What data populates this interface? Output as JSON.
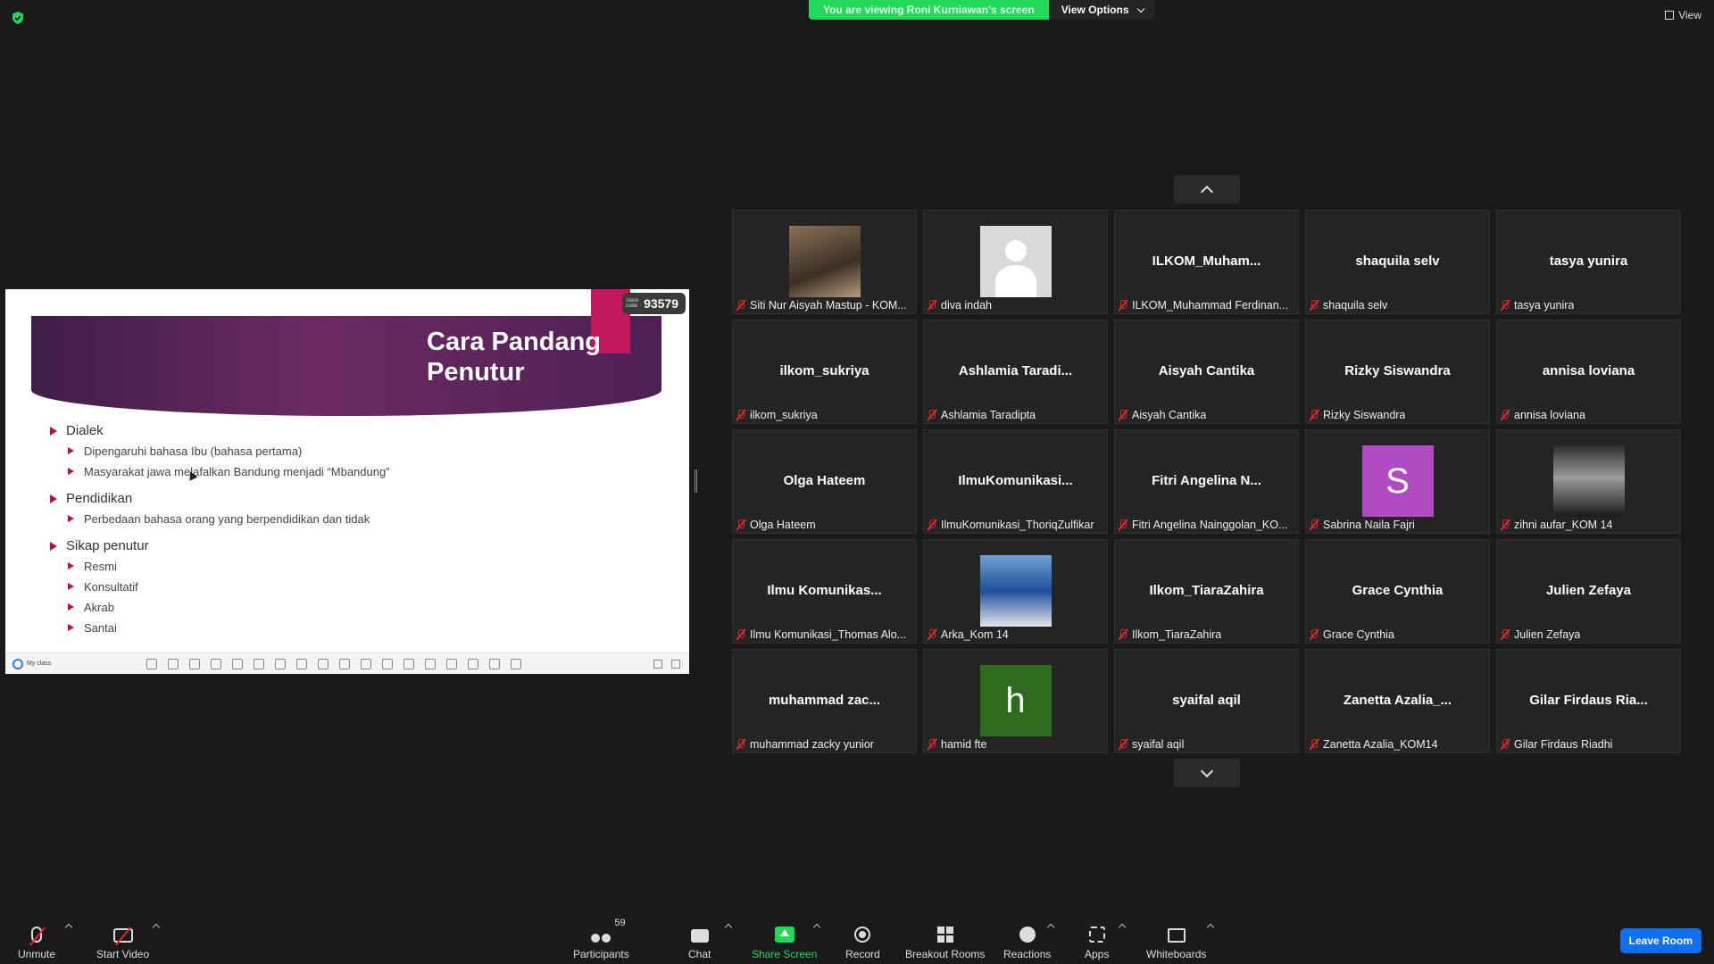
{
  "banner": {
    "viewing": "You are viewing Roni Kurniawan's screen",
    "view_options": "View Options"
  },
  "view_button": "View",
  "slide": {
    "title": "Cara Pandang Penutur",
    "class_code_label": "class code",
    "class_code": "93579",
    "bullets": [
      {
        "text": "Dialek",
        "sub": [
          "Dipengaruhi bahasa Ibu (bahasa pertama)",
          "Masyarakat jawa melafalkan Bandung menjadi “Mbandung”"
        ]
      },
      {
        "text": "Pendidikan",
        "sub": [
          "Perbedaan bahasa orang yang berpendidikan dan tidak"
        ]
      },
      {
        "text": "Sikap penutur",
        "sub": [
          "Resmi",
          "Konsultatif",
          "Akrab",
          "Santai"
        ]
      }
    ],
    "toolbar_label": "My class",
    "accent_color": "#c2185b"
  },
  "participants": [
    {
      "display": "",
      "avatar": "photo1",
      "name": "Siti Nur Aisyah Mastup - KOM..."
    },
    {
      "display": "",
      "avatar": "default",
      "name": "diva indah"
    },
    {
      "display": "ILKOM_Muham...",
      "avatar": "",
      "name": "ILKOM_Muhammad Ferdinan..."
    },
    {
      "display": "shaquila selv",
      "avatar": "",
      "name": "shaquila selv"
    },
    {
      "display": "tasya yunira",
      "avatar": "",
      "name": "tasya yunira"
    },
    {
      "display": "ilkom_sukriya",
      "avatar": "",
      "name": "ilkom_sukriya"
    },
    {
      "display": "Ashlamia Taradi...",
      "avatar": "",
      "name": "Ashlamia Taradipta"
    },
    {
      "display": "Aisyah Cantika",
      "avatar": "",
      "name": "Aisyah Cantika"
    },
    {
      "display": "Rizky Siswandra",
      "avatar": "",
      "name": "Rizky Siswandra"
    },
    {
      "display": "annisa loviana",
      "avatar": "",
      "name": "annisa loviana"
    },
    {
      "display": "Olga Hateem",
      "avatar": "",
      "name": "Olga Hateem"
    },
    {
      "display": "IlmuKomunikasi...",
      "avatar": "",
      "name": "IlmuKomunikasi_ThoriqZulfikar"
    },
    {
      "display": "Fitri Angelina N...",
      "avatar": "",
      "name": "Fitri Angelina Nainggolan_KO..."
    },
    {
      "display": "",
      "avatar": "letter",
      "letter": "S",
      "letter_color": "#b04bc4",
      "name": "Sabrina Naila Fajri"
    },
    {
      "display": "",
      "avatar": "photo2",
      "name": "zihni aufar_KOM 14"
    },
    {
      "display": "Ilmu Komunikas...",
      "avatar": "",
      "name": "Ilmu Komunikasi_Thomas Alo..."
    },
    {
      "display": "",
      "avatar": "photo3",
      "name": "Arka_Kom 14"
    },
    {
      "display": "Ilkom_TiaraZahira",
      "avatar": "",
      "name": "Ilkom_TiaraZahira"
    },
    {
      "display": "Grace Cynthia",
      "avatar": "",
      "name": "Grace Cynthia"
    },
    {
      "display": "Julien Zefaya",
      "avatar": "",
      "name": "Julien Zefaya"
    },
    {
      "display": "muhammad zac...",
      "avatar": "",
      "name": "muhammad zacky yunior"
    },
    {
      "display": "",
      "avatar": "letter",
      "letter": "h",
      "letter_color": "#2e6b1e",
      "name": "hamid fte"
    },
    {
      "display": "syaifal aqil",
      "avatar": "",
      "name": "syaifal aqil"
    },
    {
      "display": "Zanetta Azalia_...",
      "avatar": "",
      "name": "Zanetta Azalia_KOM14"
    },
    {
      "display": "Gilar Firdaus Ria...",
      "avatar": "",
      "name": "Gilar Firdaus Riadhi"
    }
  ],
  "toolbar": {
    "unmute": "Unmute",
    "start_video": "Start Video",
    "participants": "Participants",
    "participant_count": "59",
    "chat": "Chat",
    "share_screen": "Share Screen",
    "record": "Record",
    "breakout": "Breakout Rooms",
    "reactions": "Reactions",
    "apps": "Apps",
    "whiteboards": "Whiteboards",
    "leave": "Leave Room"
  },
  "colors": {
    "share_green": "#23d959",
    "leave_blue": "#0e71eb",
    "mute_red": "#e02828"
  }
}
